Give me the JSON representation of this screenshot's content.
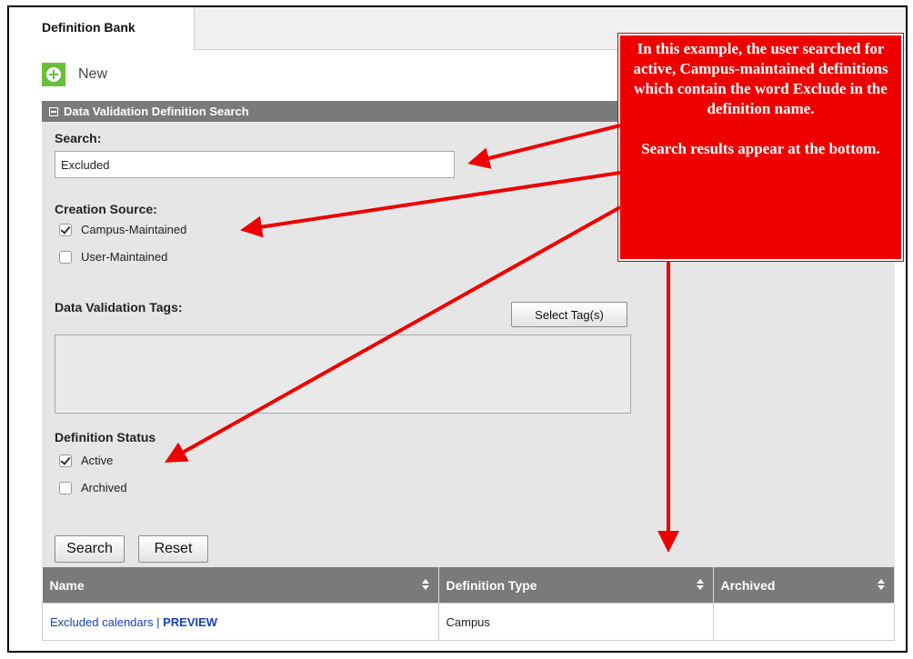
{
  "tabs": [
    {
      "label": "Definition Bank"
    }
  ],
  "toolbar": {
    "new_label": "New"
  },
  "panel": {
    "title": "Data Validation Definition Search",
    "search_label": "Search:",
    "search_value": "Excluded",
    "creation_source_label": "Creation Source:",
    "creation_options": [
      {
        "label": "Campus-Maintained",
        "checked": true
      },
      {
        "label": "User-Maintained",
        "checked": false
      }
    ],
    "tags_label": "Data Validation Tags:",
    "select_tags_button": "Select Tag(s)",
    "status_label": "Definition Status",
    "status_options": [
      {
        "label": "Active",
        "checked": true
      },
      {
        "label": "Archived",
        "checked": false
      }
    ],
    "search_button": "Search",
    "reset_button": "Reset"
  },
  "results": {
    "columns": [
      "Name",
      "Definition Type",
      "Archived"
    ],
    "rows": [
      {
        "name": "Excluded calendars",
        "separator": "|",
        "preview": "PREVIEW",
        "type": "Campus",
        "archived": ""
      }
    ]
  },
  "callout": {
    "text1": "In this example, the user searched for active, Campus-maintained definitions which contain the word Exclude in the definition name.",
    "text2": "Search results appear at the bottom."
  },
  "colors": {
    "accent_red": "#ee0000",
    "header_gray": "#7a7a7a",
    "new_green": "#6abf3a",
    "link_blue": "#1a3fbf"
  }
}
